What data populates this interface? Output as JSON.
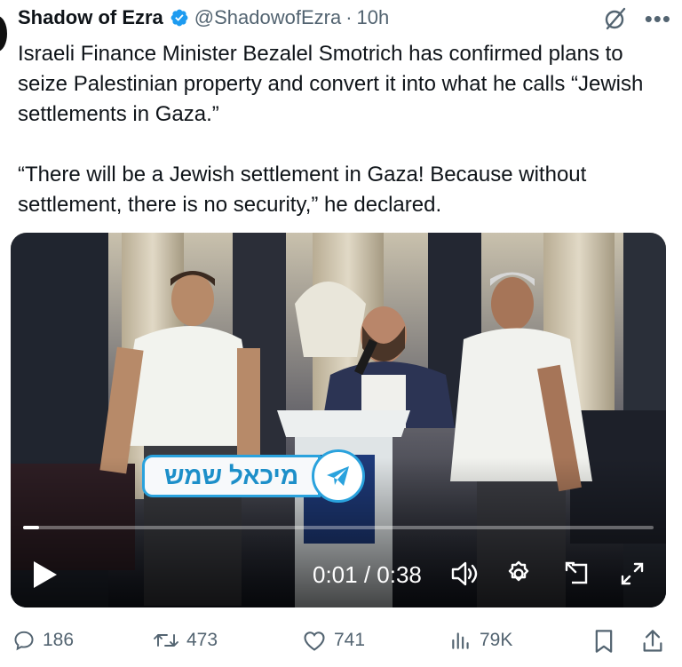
{
  "author": {
    "name": "Shadow of Ezra",
    "handle": "@ShadowofEzra",
    "separator": "·",
    "time": "10h",
    "verified": true
  },
  "tweet": {
    "paragraph1": "Israeli Finance Minister Bezalel Smotrich has confirmed plans to seize Palestinian property and convert it into what he calls “Jewish settlements in Gaza.”",
    "paragraph2": "“There will be a Jewish settlement in Gaza! Because without settlement, there is no security,” he declared."
  },
  "video": {
    "overlay_text": "מיכאל שמש",
    "timecode": "0:01 / 0:38",
    "progress_fraction": 0.026,
    "icons": [
      "play-icon",
      "volume-icon",
      "settings-icon",
      "pip-icon",
      "fullscreen-icon"
    ]
  },
  "actions": {
    "replies": "186",
    "reposts": "473",
    "likes": "741",
    "views": "79K"
  },
  "colors": {
    "verified_blue": "#1d9bf0",
    "secondary_text": "#536471",
    "telegram_blue": "#2aa2dd"
  }
}
